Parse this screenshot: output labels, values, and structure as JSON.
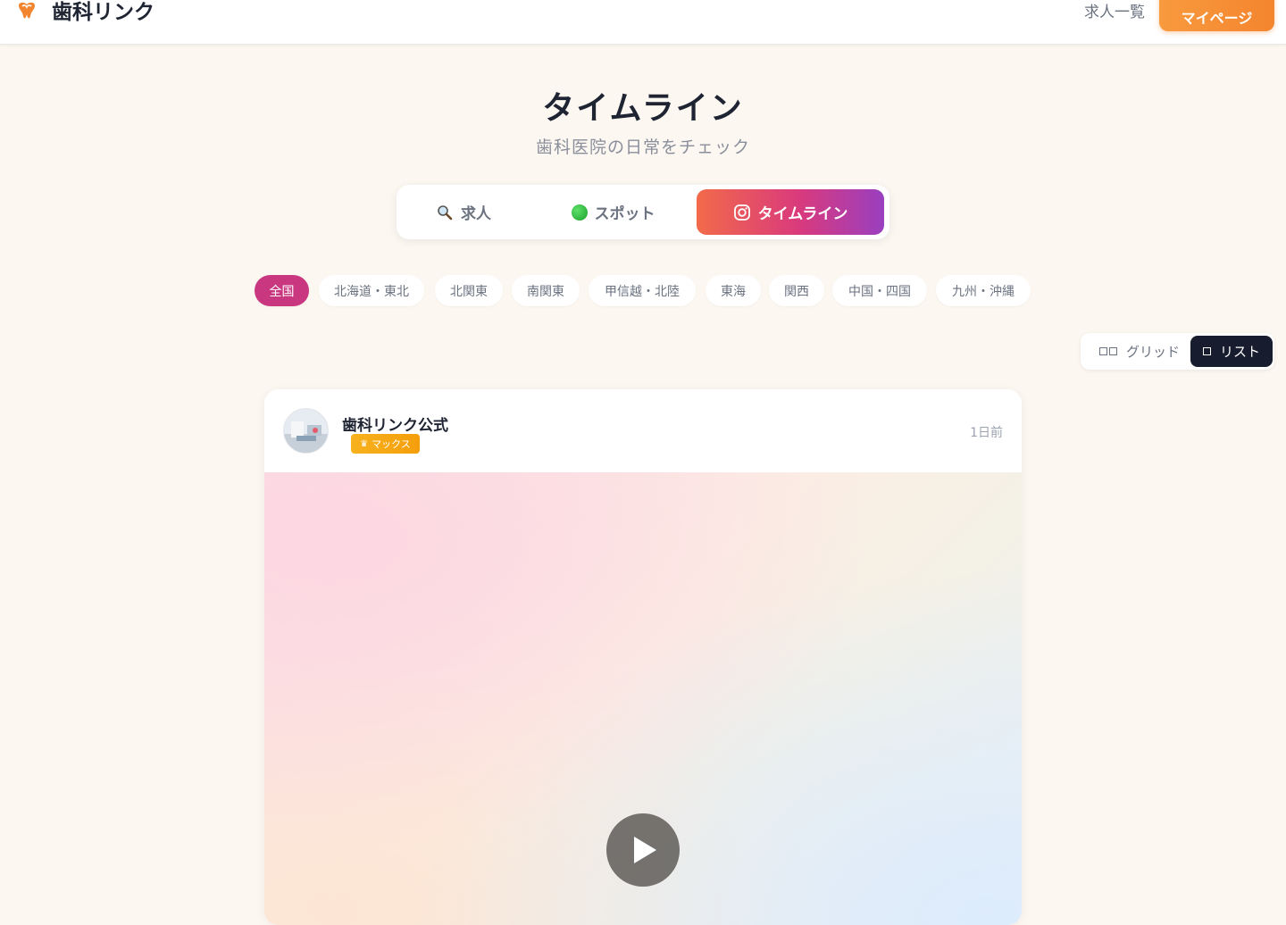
{
  "header": {
    "app_name": "歯科リンク",
    "nav_jobs": "求人一覧",
    "mypage_label": "マイページ"
  },
  "hero": {
    "title": "タイムライン",
    "subtitle": "歯科医院の日常をチェック"
  },
  "tabs": [
    {
      "label": "求人",
      "icon": "magnifier-icon"
    },
    {
      "label": "スポット",
      "icon": "green-circle-icon"
    },
    {
      "label": "タイムライン",
      "icon": "instagram-icon",
      "active": true
    }
  ],
  "regions": [
    {
      "label": "全国",
      "active": true
    },
    {
      "label": "北海道・東北"
    },
    {
      "label": "北関東"
    },
    {
      "label": "南関東"
    },
    {
      "label": "甲信越・北陸"
    },
    {
      "label": "東海"
    },
    {
      "label": "関西"
    },
    {
      "label": "中国・四国"
    },
    {
      "label": "九州・沖縄"
    }
  ],
  "view_toggle": {
    "grid_label": "グリッド",
    "list_label": "リスト",
    "selected": "list"
  },
  "post": {
    "author": "歯科リンク公式",
    "badge": "マックス",
    "time": "1日前"
  },
  "colors": {
    "accent_orange": "#f4852f",
    "active_chip": "#c93781",
    "list_active": "#171c2e"
  }
}
